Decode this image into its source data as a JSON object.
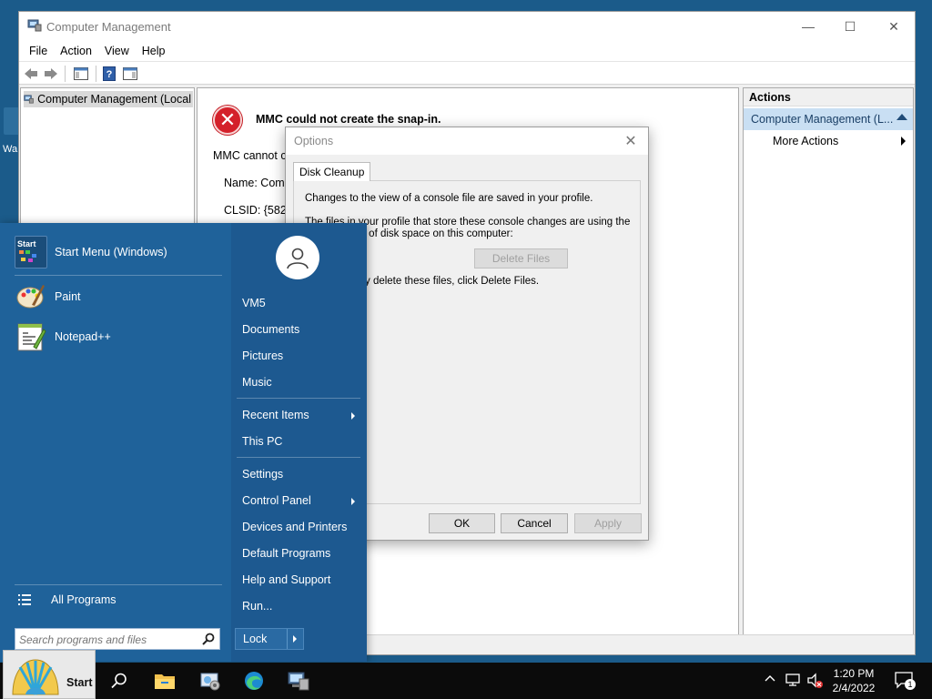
{
  "desktop": {
    "partial_label": "Wa"
  },
  "window": {
    "title": "Computer Management",
    "menu": [
      "File",
      "Action",
      "View",
      "Help"
    ],
    "tree_root": "Computer Management (Local",
    "controls": {
      "minimize": "—",
      "maximize": "☐",
      "close": "✕"
    }
  },
  "error": {
    "heading": "MMC could not create the snap-in.",
    "line1": "MMC cannot cr",
    "name_line": "Name: Comp",
    "clsid_line": "CLSID: {58221"
  },
  "actions": {
    "header": "Actions",
    "group": "Computer Management (L...",
    "more": "More Actions"
  },
  "dialog": {
    "title": "Options",
    "close": "✕",
    "tab": "Disk Cleanup",
    "text1": "Changes to the view of a console file are saved in your profile.",
    "text2a": "The files in your profile that store these console changes are using the",
    "text2b": "unt of disk space on this computer:",
    "text3": "y delete these files, click Delete Files.",
    "delete_button": "Delete Files",
    "ok": "OK",
    "cancel": "Cancel",
    "apply": "Apply"
  },
  "start_menu": {
    "pinned": [
      {
        "label": "Start Menu (Windows)",
        "icon": "start-menu-app-icon",
        "badge": "Start"
      },
      {
        "label": "Paint",
        "icon": "paint-icon"
      },
      {
        "label": "Notepad++",
        "icon": "notepad-plus-plus-icon"
      }
    ],
    "all_programs": "All Programs",
    "search_placeholder": "Search programs and files",
    "right_links": {
      "user": "VM5",
      "documents": "Documents",
      "pictures": "Pictures",
      "music": "Music",
      "recent": "Recent Items",
      "thispc": "This PC",
      "settings": "Settings",
      "control_panel": "Control Panel",
      "devices": "Devices and Printers",
      "default_programs": "Default Programs",
      "help": "Help and Support",
      "run": "Run..."
    },
    "lock": "Lock"
  },
  "taskbar": {
    "start_label": "Start",
    "time": "1:20 PM",
    "date": "2/4/2022",
    "notifications": "1",
    "icons": [
      "search-icon",
      "file-explorer-icon",
      "control-panel-icon",
      "edge-icon",
      "computer-management-icon"
    ]
  }
}
